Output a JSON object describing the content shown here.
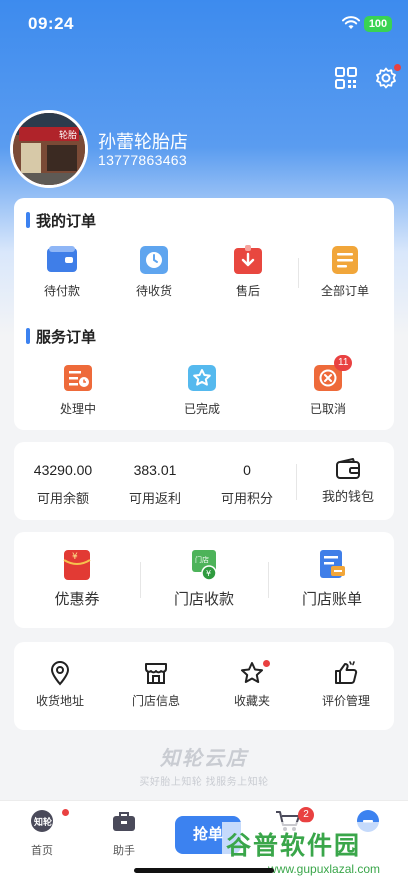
{
  "status_bar": {
    "time": "09:24",
    "battery": "100"
  },
  "profile": {
    "shop_name": "孙蕾轮胎店",
    "phone": "13777863463",
    "avatar_sign": "轮胎"
  },
  "my_orders": {
    "title": "我的订单",
    "items": [
      {
        "label": "待付款",
        "icon": "wallet-icon"
      },
      {
        "label": "待收货",
        "icon": "clock-icon"
      },
      {
        "label": "售后",
        "icon": "return-icon"
      },
      {
        "label": "全部订单",
        "icon": "list-icon"
      }
    ]
  },
  "service_orders": {
    "title": "服务订单",
    "items": [
      {
        "label": "处理中",
        "icon": "processing-icon"
      },
      {
        "label": "已完成",
        "icon": "star-done-icon"
      },
      {
        "label": "已取消",
        "icon": "cancel-icon",
        "badge": "11"
      }
    ]
  },
  "wallet": {
    "items": [
      {
        "value": "43290.00",
        "label": "可用余额"
      },
      {
        "value": "383.01",
        "label": "可用返利"
      },
      {
        "value": "0",
        "label": "可用积分"
      }
    ],
    "wallet_label": "我的钱包"
  },
  "finance": {
    "items": [
      {
        "label": "优惠券",
        "icon": "coupon-icon"
      },
      {
        "label": "门店收款",
        "icon": "store-payment-icon",
        "icon_text": "门店"
      },
      {
        "label": "门店账单",
        "icon": "bill-icon"
      }
    ]
  },
  "tools": {
    "items": [
      {
        "label": "收货地址",
        "icon": "location-icon"
      },
      {
        "label": "门店信息",
        "icon": "store-icon"
      },
      {
        "label": "收藏夹",
        "icon": "star-icon"
      },
      {
        "label": "评价管理",
        "icon": "thumbs-up-icon"
      }
    ]
  },
  "brand": {
    "logo": "知轮云店",
    "slogan": "买好胎上知轮  找服务上知轮"
  },
  "tabbar": {
    "items": [
      {
        "label": "首页",
        "icon": "home-logo-icon",
        "icon_text": "知轮"
      },
      {
        "label": "助手",
        "icon": "briefcase-icon"
      },
      {
        "label": "",
        "icon": "cart-icon",
        "badge": "2"
      },
      {
        "label": "",
        "icon": "user-icon"
      }
    ],
    "grab_label": "抢单"
  },
  "watermark": {
    "text": "谷普软件园",
    "url": "www.gupuxlazal.com"
  },
  "colors": {
    "accent": "#3c82f0",
    "badge": "#e94141"
  }
}
